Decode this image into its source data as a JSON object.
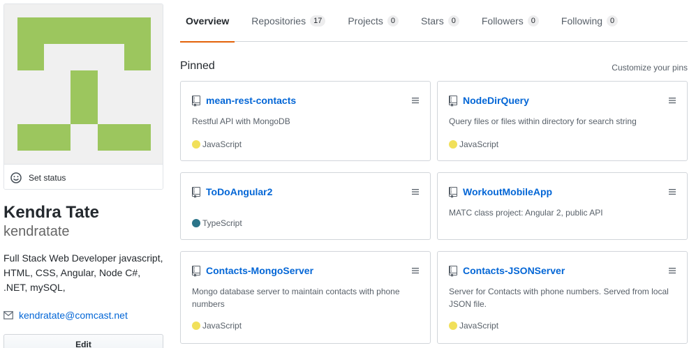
{
  "profile": {
    "set_status_label": "Set status",
    "full_name": "Kendra Tate",
    "username": "kendratate",
    "bio": "Full Stack Web Developer javascript, HTML, CSS, Angular, Node C#, .NET, mySQL,",
    "email": "kendratate@comcast.net",
    "edit_label": "Edit",
    "identicon_color": "#9cc65e"
  },
  "tabs": [
    {
      "label": "Overview",
      "count": null
    },
    {
      "label": "Repositories",
      "count": "17"
    },
    {
      "label": "Projects",
      "count": "0"
    },
    {
      "label": "Stars",
      "count": "0"
    },
    {
      "label": "Followers",
      "count": "0"
    },
    {
      "label": "Following",
      "count": "0"
    }
  ],
  "pinned": {
    "title": "Pinned",
    "customize_label": "Customize your pins",
    "repos": [
      {
        "name": "mean-rest-contacts",
        "description": "Restful API with MongoDB",
        "language": "JavaScript",
        "language_color": "#f1e05a"
      },
      {
        "name": "NodeDirQuery",
        "description": "Query files or files within directory for search string",
        "language": "JavaScript",
        "language_color": "#f1e05a"
      },
      {
        "name": "ToDoAngular2",
        "description": "",
        "language": "TypeScript",
        "language_color": "#2b7489"
      },
      {
        "name": "WorkoutMobileApp",
        "description": "MATC class project: Angular 2, public API",
        "language": "",
        "language_color": ""
      },
      {
        "name": "Contacts-MongoServer",
        "description": "Mongo database server to maintain contacts with phone numbers",
        "language": "JavaScript",
        "language_color": "#f1e05a"
      },
      {
        "name": "Contacts-JSONServer",
        "description": "Server for Contacts with phone numbers. Served from local JSON file.",
        "language": "JavaScript",
        "language_color": "#f1e05a"
      }
    ]
  }
}
